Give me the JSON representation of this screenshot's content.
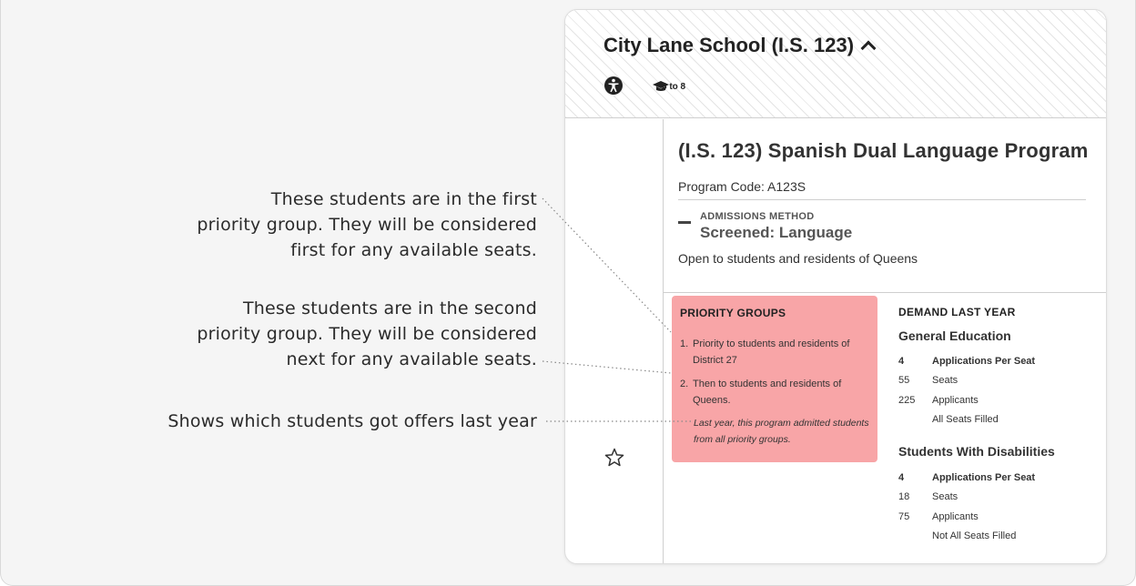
{
  "annotations": {
    "first": [
      "These students are in the first",
      "priority group. They will be considered",
      "first for any available seats."
    ],
    "second": [
      "These students are in the second",
      "priority group. They will be considered",
      "next for any available seats."
    ],
    "offers": "Shows which students got offers last year"
  },
  "school": {
    "name": "City Lane School (I.S. 123)",
    "grades": "6 to 8"
  },
  "program": {
    "title": "(I.S. 123) Spanish Dual Language Program",
    "code": "Program Code: A123S",
    "admissions_label": "ADMISSIONS METHOD",
    "admissions_value": "Screened: Language",
    "open_to": "Open to students and residents of Queens"
  },
  "priority_groups": {
    "title": "PRIORITY GROUPS",
    "items": [
      {
        "num": "1.",
        "text": "Priority to students and residents of District 27"
      },
      {
        "num": "2.",
        "text": "Then to students and residents of Queens."
      }
    ],
    "note": "Last year, this program admitted students from all priority groups."
  },
  "demand": {
    "title": "DEMAND LAST YEAR",
    "general": {
      "title": "General Education",
      "apps_per_seat": {
        "n": "4",
        "label": "Applications Per Seat"
      },
      "seats": {
        "n": "55",
        "label": "Seats"
      },
      "applicants": {
        "n": "225",
        "label": "Applicants"
      },
      "status": "All Seats Filled"
    },
    "swd": {
      "title": "Students With Disabilities",
      "apps_per_seat": {
        "n": "4",
        "label": "Applications Per Seat"
      },
      "seats": {
        "n": "18",
        "label": "Seats"
      },
      "applicants": {
        "n": "75",
        "label": "Applicants"
      },
      "status": "Not All Seats Filled"
    }
  },
  "colors": {
    "priority_bg": "#f8a5a7",
    "frame_bg": "#f5f5f5"
  },
  "icons": [
    "chevron-up-icon",
    "accessibility-icon",
    "graduation-cap-icon",
    "star-icon",
    "minus-icon"
  ]
}
